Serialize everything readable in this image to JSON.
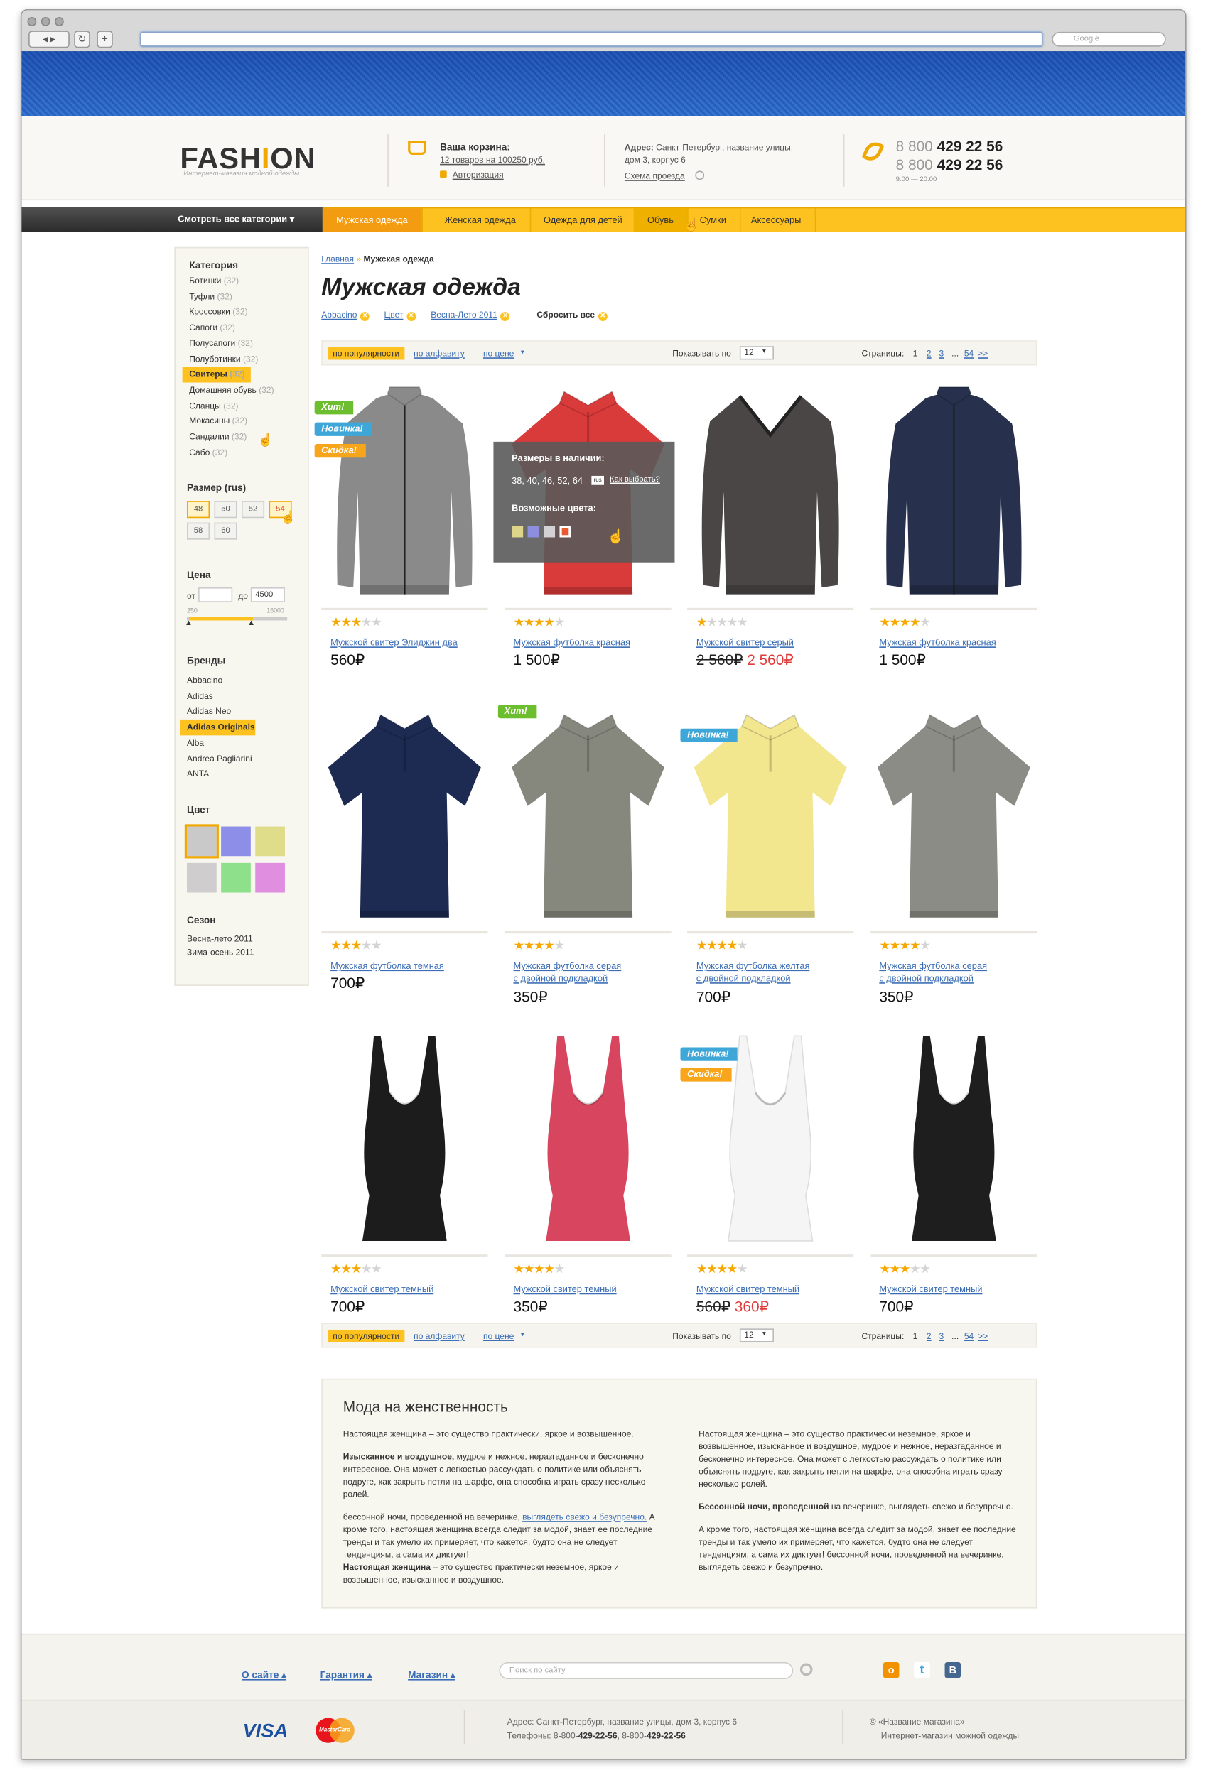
{
  "browser": {
    "search_placeholder": "Google"
  },
  "brand": {
    "logo": "FASHION",
    "logo_a": "FASH",
    "logo_i": "I",
    "logo_b": "ON",
    "tagline": "Интернет-магазин модной одежды"
  },
  "cart": {
    "title": "Ваша корзина:",
    "summary": "12 товаров на 100250 руб.",
    "login": "Авторизация"
  },
  "address": {
    "label": "Адрес:",
    "text": "Санкт-Петербург, название улицы,",
    "text2": "дом 3, корпус 6",
    "map_link": "Схема проезда"
  },
  "phones": {
    "prefix": "8 800",
    "p1": "429 22 56",
    "p2": "429 22 56",
    "hours": "9:00 — 20:00"
  },
  "nav": {
    "all": "Смотреть все категории",
    "items": [
      "Мужская одежда",
      "Женская одежда",
      "Одежда для детей",
      "Обувь",
      "Сумки",
      "Аксессуары"
    ]
  },
  "sidebar": {
    "category_title": "Категория",
    "categories": [
      {
        "n": "Ботинки",
        "c": "(32)"
      },
      {
        "n": "Туфли",
        "c": "(32)"
      },
      {
        "n": "Кроссовки",
        "c": "(32)"
      },
      {
        "n": "Сапоги",
        "c": "(32)"
      },
      {
        "n": "Полусапоги",
        "c": "(32)"
      },
      {
        "n": "Полуботинки",
        "c": "(32)"
      },
      {
        "n": "Свитеры",
        "c": "(32)"
      },
      {
        "n": "Домашняя обувь",
        "c": "(32)"
      },
      {
        "n": "Сланцы",
        "c": "(32)"
      },
      {
        "n": "Мокасины",
        "c": "(32)"
      },
      {
        "n": "Сандалии",
        "c": "(32)"
      },
      {
        "n": "Сабо",
        "c": "(32)"
      }
    ],
    "size_title": "Размер (rus)",
    "sizes": [
      "48",
      "50",
      "52",
      "54",
      "58",
      "60"
    ],
    "price_title": "Цена",
    "price_from_label": "от",
    "price_to_label": "до",
    "price_to": "4500",
    "range_min": "250",
    "range_max": "16000",
    "brands_title": "Бренды",
    "brands": [
      "Abbacino",
      "Adidas",
      "Adidas Neo",
      "Adidas Originals",
      "Alba",
      "Andrea Pagliarini",
      "ANTA"
    ],
    "color_title": "Цвет",
    "colors": [
      "#c9c9c9",
      "#8c8ee8",
      "#dfdc8a",
      "#cfcdce",
      "#8ee08a",
      "#e08fe0"
    ],
    "season_title": "Сезон",
    "seasons": [
      "Весна-лето 2011",
      "Зима-осень 2011"
    ]
  },
  "breadcrumb": {
    "home": "Главная",
    "sep": "»",
    "current": "Мужская одежда"
  },
  "page_title": "Мужская одежда",
  "filters": {
    "items": [
      "Abbacino",
      "Цвет",
      "Весна-Лето 2011"
    ],
    "reset": "Сбросить все"
  },
  "sort": {
    "popular": "по популярности",
    "alpha": "по алфавиту",
    "price": "по цене",
    "show_label": "Показывать по",
    "show_value": "12",
    "pages_label": "Страницы:",
    "p1": "1",
    "p2": "2",
    "p3": "3",
    "dots": "...",
    "last": "54",
    "next": ">>"
  },
  "tags": {
    "hit": "Хит!",
    "new": "Новинка!",
    "sale": "Скидка!"
  },
  "popup": {
    "sizes_title": "Размеры в наличии:",
    "sizes": "38, 40, 46, 52, 64",
    "how": "Как выбрать?",
    "colors_title": "Возможные цвета:",
    "colors": [
      "#dcd58a",
      "#8d8ee0",
      "#d3d1d3",
      "#e85a30"
    ]
  },
  "products": [
    {
      "name": "Мужской свитер Элиджин два",
      "price": "560₽",
      "stars": 3,
      "img": "jacket",
      "color": "#8a8a8a"
    },
    {
      "name": "Мужская футболка красная",
      "price": "1 500₽",
      "stars": 4,
      "img": "polo",
      "color": "#d93a3a"
    },
    {
      "name": "Мужской свитер серый",
      "old": "2 560₽",
      "new": "2 560₽",
      "stars": 1,
      "img": "sweater",
      "color": "#4a4646"
    },
    {
      "name": "Мужская футболка красная",
      "price": "1 500₽",
      "stars": 4,
      "img": "jacket",
      "color": "#27304c"
    },
    {
      "name": "Мужская футболка темная",
      "price": "700₽",
      "stars": 3,
      "img": "polo",
      "color": "#1d2a52"
    },
    {
      "name": "Мужская футболка серая",
      "name2": "с двойной подкладкой",
      "price": "350₽",
      "stars": 4,
      "img": "polo",
      "color": "#86887e"
    },
    {
      "name": "Мужская футболка желтая",
      "name2": "с двойной подкладкой",
      "price": "700₽",
      "stars": 4,
      "img": "polo",
      "color": "#f2e68e"
    },
    {
      "name": "Мужская футболка серая",
      "name2": "с двойной подкладкой",
      "price": "350₽",
      "stars": 4,
      "img": "polo",
      "color": "#8b8c85"
    },
    {
      "name": "Мужской свитер темный",
      "price": "700₽",
      "stars": 3,
      "img": "tank",
      "color": "#1c1c1c"
    },
    {
      "name": "Мужской свитер темный",
      "price": "350₽",
      "stars": 4,
      "img": "tank",
      "color": "#d8455f"
    },
    {
      "name": "Мужской свитер темный",
      "old": "560₽",
      "new": "360₽",
      "stars": 4,
      "img": "tank",
      "color": "#f5f5f5"
    },
    {
      "name": "Мужской свитер темный",
      "price": "700₽",
      "stars": 3,
      "img": "tank",
      "color": "#1e1e1e"
    }
  ],
  "seo": {
    "title": "Мода на женственность",
    "l1": "Настоящая женщина – это существо практически, яркое и возвышенное.",
    "l2b": "Изысканное и воздушное,",
    "l2": " мудрое и нежное, неразгаданное и бесконечно интересное. Она может с легкостью рассуждать о политике или объяснять подруге, как закрыть петли на шарфе, она способна играть сразу несколько ролей.",
    "l3": "бессонной ночи, проведенной на вечеринке, ",
    "l3link": "выглядеть свежо и безупречно.",
    "l4": " А кроме того, настоящая женщина всегда следит за модой, знает ее последние тренды и так умело их примеряет, что кажется, будто она не следует тенденциям, а сама их диктует!",
    "l5b": "Настоящая женщина",
    "l5": " – это существо практически неземное, яркое и возвышенное, изысканное и воздушное.",
    "r1": "Настоящая женщина – это существо практически неземное, яркое и возвышенное, изысканное и воздушное, мудрое и нежное, неразгаданное и бесконечно интересное. Она может с легкостью рассуждать о политике или объяснять подруге, как закрыть петли на шарфе, она способна играть сразу несколько ролей.",
    "r2b": "Бессонной ночи, проведенной",
    "r2": " на вечеринке, выглядеть свежо и безупречно.",
    "r3": "А кроме того, настоящая женщина всегда следит за модой, знает ее последние тренды и так умело их примеряет, что кажется, будто она не следует тенденциям, а сама их диктует! бессонной ночи, проведенной на вечеринке, выглядеть свежо и безупречно."
  },
  "footer": {
    "links": [
      "О сайте",
      "Гарантия",
      "Магазин"
    ],
    "search_placeholder": "Поиск по сайту",
    "visa": "VISA",
    "mc": "MasterCard",
    "addr": "Адрес: Санкт-Петербург, название улицы, дом 3, корпус 6",
    "tel_label": "Телефоны: 8-800-",
    "tel1": "429-22-56",
    "tel_sep": ", 8-800-",
    "tel2": "429-22-56",
    "copy": "©  «Название магазина»",
    "copy2": "Интернет-магазин можной одежды"
  }
}
